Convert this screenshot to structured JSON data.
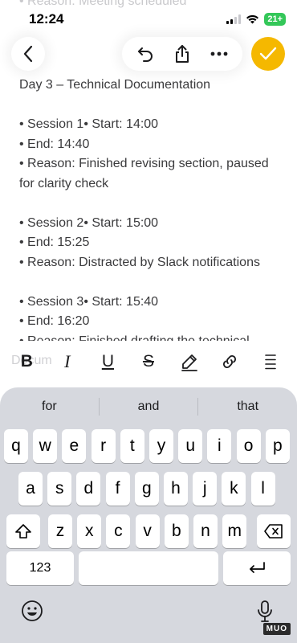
{
  "status": {
    "ghost_line": "• Reason: Meeting scheduled",
    "time": "12:24",
    "battery": "21+"
  },
  "note": {
    "lines": [
      "Day 3 – Technical Documentation",
      "",
      "• Session 1• Start: 14:00",
      "• End: 14:40",
      "• Reason: Finished revising section, paused for clarity check",
      "",
      "• Session 2• Start: 15:00",
      "• End: 15:25",
      "• Reason: Distracted by Slack notifications",
      "",
      "• Session 3• Start: 15:40",
      "• End: 16:20",
      "• Reason: Finished drafting the technical"
    ]
  },
  "format_bar": {
    "bold": "B",
    "italic": "I",
    "underline": "U",
    "strikethrough": "S",
    "ghost": "Docum"
  },
  "keyboard": {
    "suggestions": [
      "for",
      "and",
      "that"
    ],
    "row1": [
      "q",
      "w",
      "e",
      "r",
      "t",
      "y",
      "u",
      "i",
      "o",
      "p"
    ],
    "row2": [
      "a",
      "s",
      "d",
      "f",
      "g",
      "h",
      "j",
      "k",
      "l"
    ],
    "row3": [
      "z",
      "x",
      "c",
      "v",
      "b",
      "n",
      "m"
    ],
    "numbers_key": "123",
    "space_key": ""
  },
  "watermark": "MUO",
  "colors": {
    "accent": "#f5b800",
    "keyboard_bg": "#d6d8de"
  }
}
